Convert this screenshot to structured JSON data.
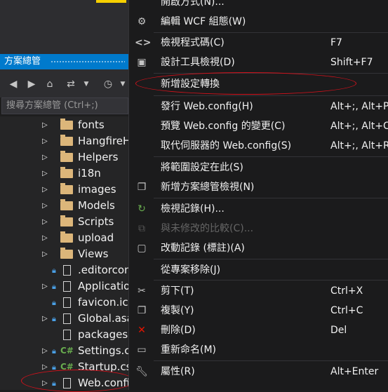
{
  "solution_explorer": {
    "title": "方案總管",
    "search_placeholder": "搜尋方案總管 (Ctrl+;)",
    "toolbar_icons": [
      "back-icon",
      "forward-icon",
      "home-icon",
      "sync-icon",
      "chevron-down-icon",
      "history-icon",
      "chevron-down-icon"
    ],
    "items": [
      {
        "label": "fonts",
        "type": "folder"
      },
      {
        "label": "HangfireH",
        "type": "folder"
      },
      {
        "label": "Helpers",
        "type": "folder"
      },
      {
        "label": "i18n",
        "type": "folder"
      },
      {
        "label": "images",
        "type": "folder"
      },
      {
        "label": "Models",
        "type": "folder"
      },
      {
        "label": "Scripts",
        "type": "folder"
      },
      {
        "label": "upload",
        "type": "folder"
      },
      {
        "label": "Views",
        "type": "folder"
      },
      {
        "label": ".editorcon",
        "type": "file"
      },
      {
        "label": "Application",
        "type": "file"
      },
      {
        "label": "favicon.ico",
        "type": "file"
      },
      {
        "label": "Global.asa",
        "type": "file"
      },
      {
        "label": "packages.c",
        "type": "file"
      },
      {
        "label": "Settings.cs",
        "type": "cs"
      },
      {
        "label": "Startup.cs",
        "type": "cs"
      },
      {
        "label": "Web.config",
        "type": "file"
      }
    ]
  },
  "context_menu": {
    "partial_top": "開啟方式(N)...",
    "items": [
      {
        "label": "編輯 WCF 組態(W)",
        "shortcut": "",
        "icon": "gear-icon"
      },
      {
        "label": "檢視程式碼(C)",
        "shortcut": "F7",
        "icon": "code-icon"
      },
      {
        "label": "設計工具檢視(D)",
        "shortcut": "Shift+F7",
        "icon": "designer-icon"
      },
      {
        "label": "新增設定轉換",
        "shortcut": "",
        "icon": ""
      },
      {
        "label": "發行 Web.config(H)",
        "shortcut": "Alt+;, Alt+P",
        "icon": ""
      },
      {
        "label": "預覽 Web.config 的變更(C)",
        "shortcut": "Alt+;, Alt+C",
        "icon": ""
      },
      {
        "label": "取代伺服器的 Web.config(S)",
        "shortcut": "Alt+;, Alt+R",
        "icon": ""
      },
      {
        "label": "將範圍設定在此(S)",
        "shortcut": "",
        "icon": ""
      },
      {
        "label": "新增方案總管檢視(N)",
        "shortcut": "",
        "icon": "new-view-icon"
      },
      {
        "label": "檢視記錄(H)...",
        "shortcut": "",
        "icon": "history-icon"
      },
      {
        "label": "與未修改的比較(C)...",
        "shortcut": "",
        "icon": "compare-icon",
        "disabled": true
      },
      {
        "label": "改動記錄 (標註)(A)",
        "shortcut": "",
        "icon": "annotate-icon"
      },
      {
        "label": "從專案移除(J)",
        "shortcut": "",
        "icon": ""
      },
      {
        "label": "剪下(T)",
        "shortcut": "Ctrl+X",
        "icon": "scissors-icon"
      },
      {
        "label": "複製(Y)",
        "shortcut": "Ctrl+C",
        "icon": "copy-icon"
      },
      {
        "label": "刪除(D)",
        "shortcut": "Del",
        "icon": "delete-icon"
      },
      {
        "label": "重新命名(M)",
        "shortcut": "",
        "icon": "rename-icon"
      },
      {
        "label": "屬性(R)",
        "shortcut": "Alt+Enter",
        "icon": "wrench-icon"
      }
    ]
  },
  "colors": {
    "accent": "#007acc",
    "highlight_ellipse": "#d4111b",
    "folder": "#dcb67a",
    "csharp": "#68ab4e",
    "delete_icon": "#e51400",
    "history_icon": "#68ab4e"
  }
}
